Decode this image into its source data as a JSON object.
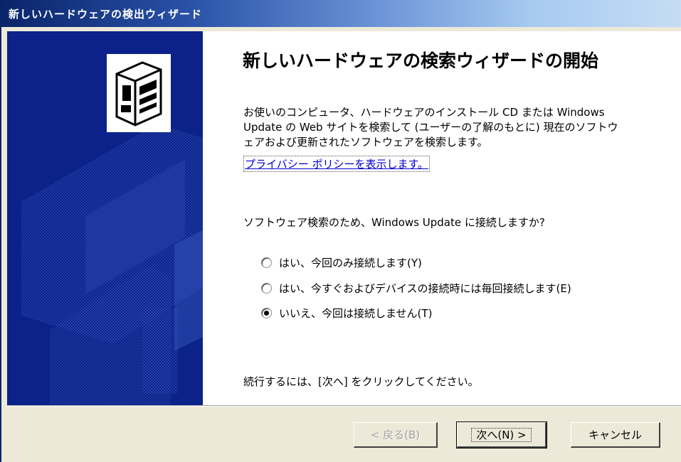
{
  "window": {
    "title": "新しいハードウェアの検出ウィザード"
  },
  "sidebar": {
    "icon": "hardware-wizard-icon"
  },
  "content": {
    "heading": "新しいハードウェアの検索ウィザードの開始",
    "description_lines": [
      "お使いのコンピュータ、ハードウェアのインストール CD または Windows",
      "Update の Web サイトを検索して (ユーザーの了解のもとに) 現在のソフトウ",
      "ェアおよび更新されたソフトウェアを検索します。"
    ],
    "privacy_link": "プライバシー ポリシーを表示します。",
    "question": "ソフトウェア検索のため、Windows Update に接続しますか?",
    "options": [
      {
        "label": "はい、今回のみ接続します(Y)",
        "selected": false
      },
      {
        "label": "はい、今すぐおよびデバイスの接続時には毎回接続します(E)",
        "selected": false
      },
      {
        "label": "いいえ、今回は接続しません(T)",
        "selected": true
      }
    ],
    "continue_text": "続行するには、[次へ] をクリックしてください。"
  },
  "buttons": {
    "back": "< 戻る(B)",
    "next": "次へ(N) >",
    "cancel": "キャンセル"
  },
  "colors": {
    "title_start": "#0a246a",
    "title_end": "#c6dcf4",
    "sidebar": "#0a2289",
    "link": "#0000cc",
    "dialog_face": "#ece9d8"
  }
}
